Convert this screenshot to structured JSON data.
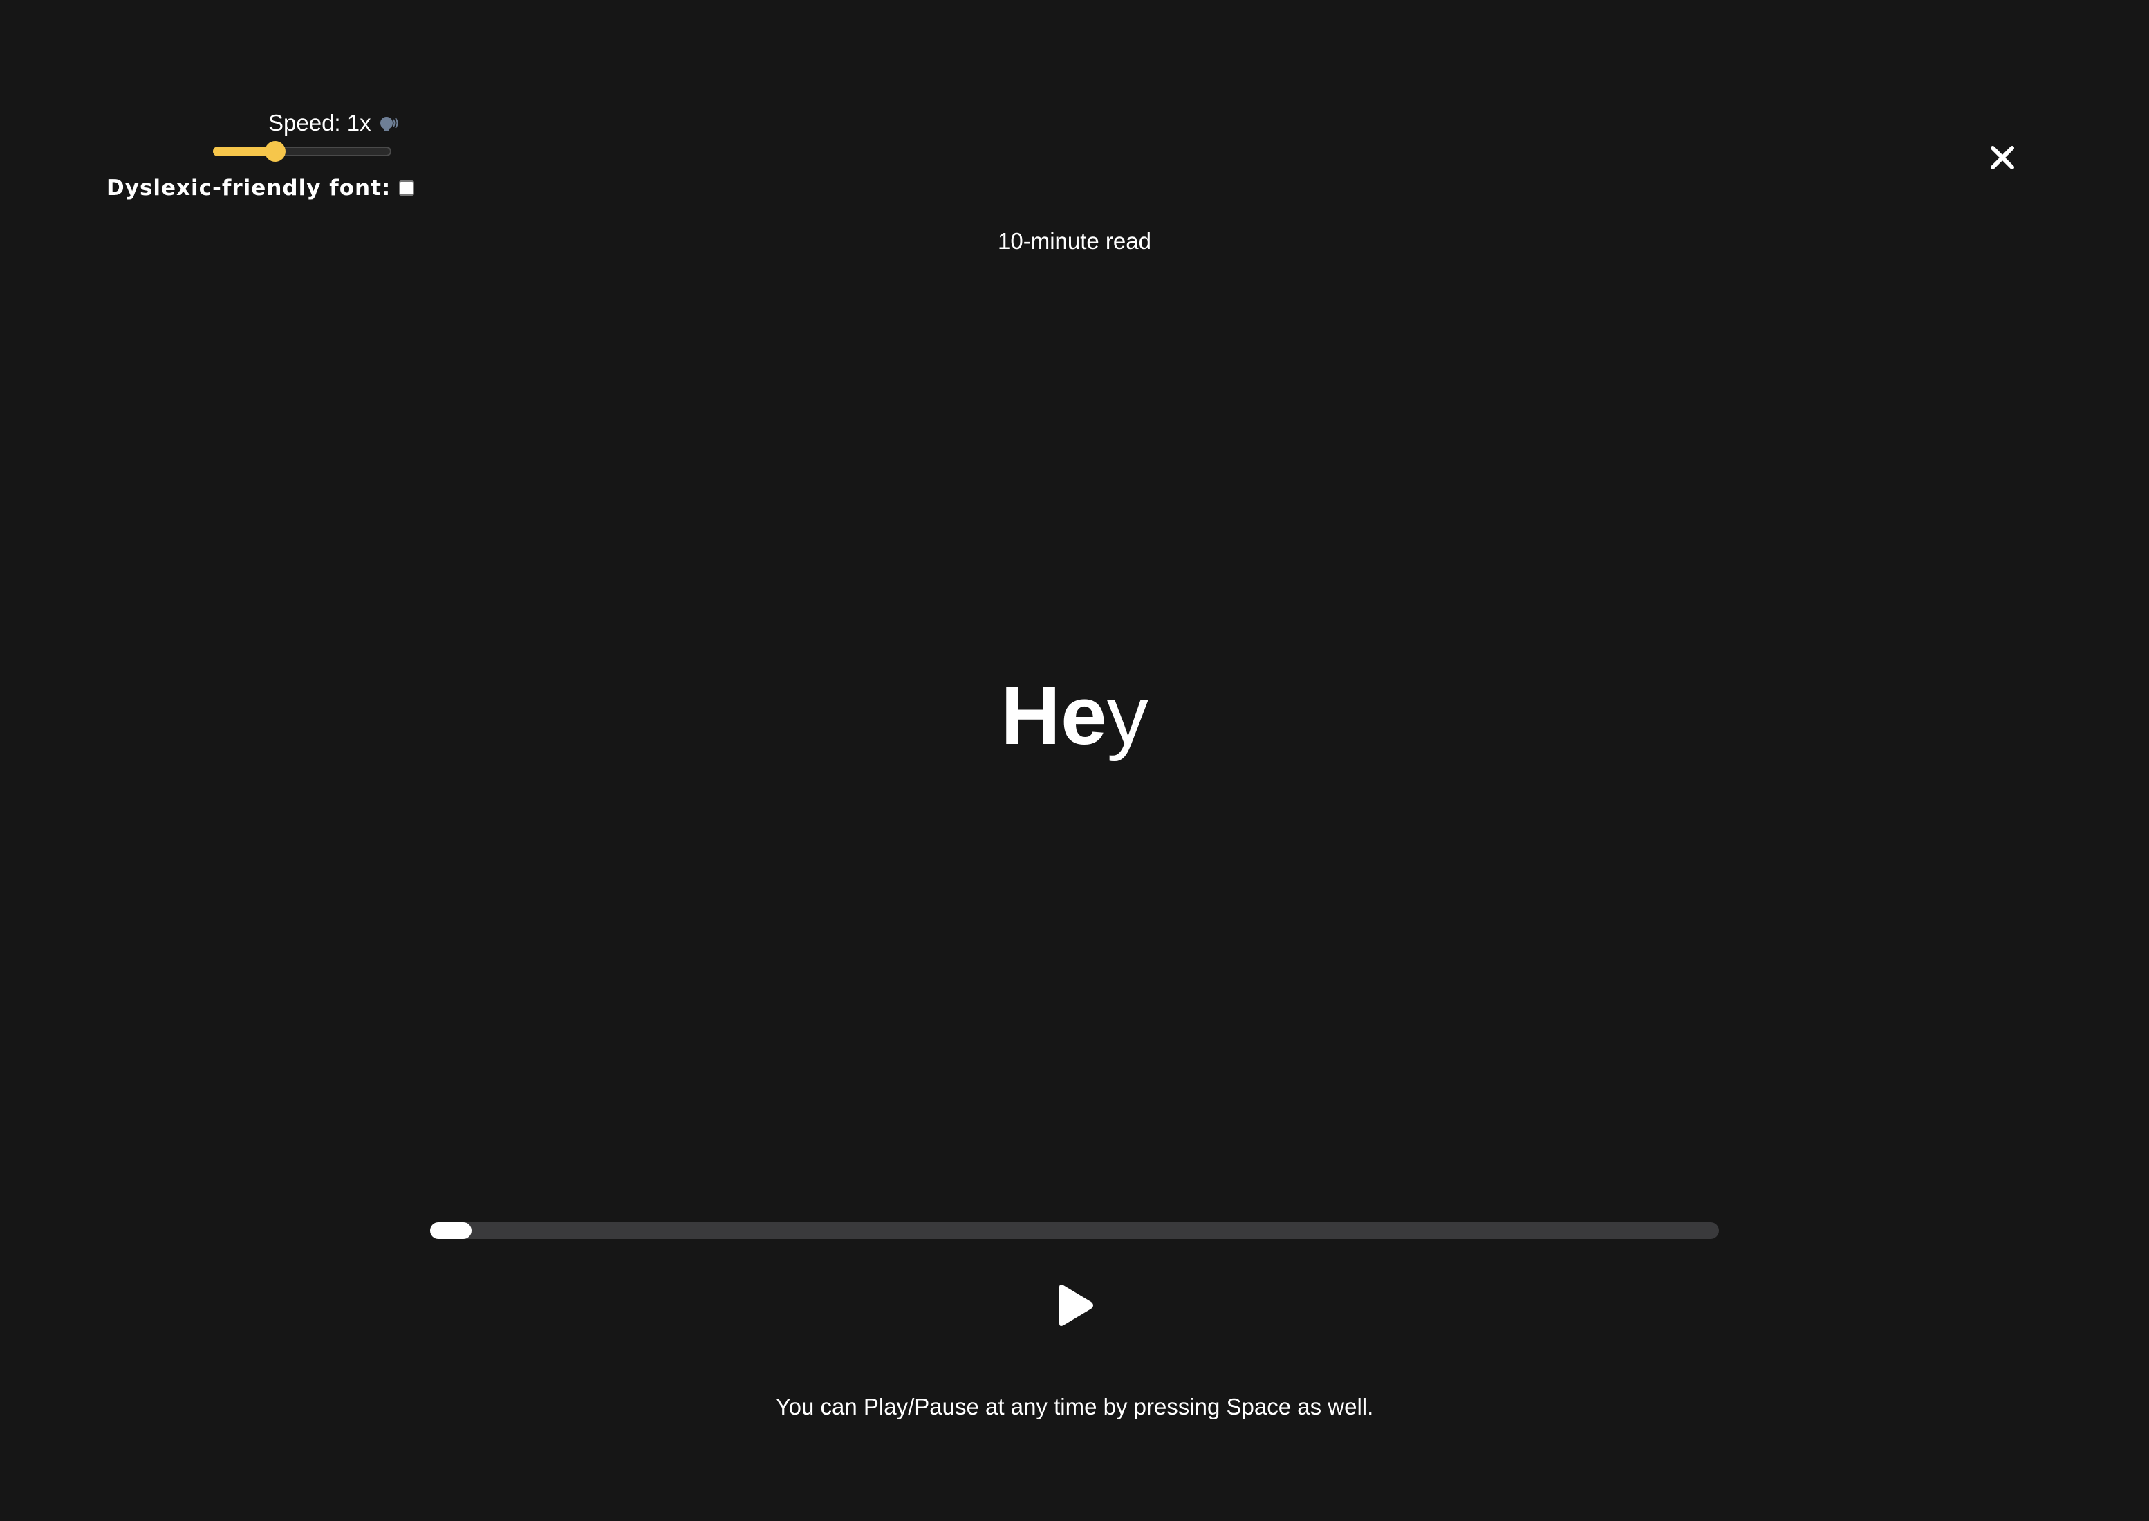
{
  "settings": {
    "speed_label": "Speed: 1x",
    "speed_icon": "speaking-head-icon",
    "speed_level": 0.35,
    "dyslexic_label": "Dyslexic-friendly font:",
    "dyslexic_checked": false
  },
  "header": {
    "read_time": "10-minute read",
    "close_icon": "close-icon"
  },
  "reader": {
    "word_bold": "He",
    "word_rest": "y",
    "progress": 0.032
  },
  "controls": {
    "play_icon": "play-icon",
    "hint": "You can Play/Pause at any time by pressing Space as well."
  },
  "colors": {
    "background": "#161616",
    "accent": "#f6c64b",
    "track": "#3a3a3c",
    "text": "#ffffff"
  }
}
